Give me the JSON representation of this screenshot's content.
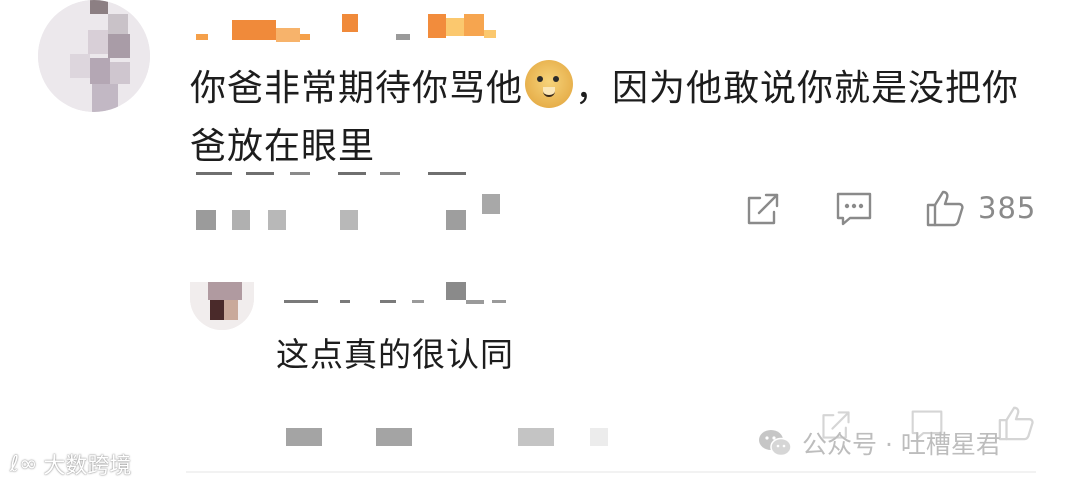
{
  "comment": {
    "text_before": "你爸非常期待你骂他",
    "emoji": "doge",
    "text_after": "，因为他敢说你就是没把你爸放在眼里",
    "like_count": "385"
  },
  "reply": {
    "text": "这点真的很认同"
  },
  "watermarks": {
    "left": "大数跨境",
    "right": "公众号 · 吐槽星君"
  },
  "colors": {
    "text": "#1d1d1d",
    "icon_gray": "#8a8a8a",
    "censor_orange": "#f08a3a"
  }
}
